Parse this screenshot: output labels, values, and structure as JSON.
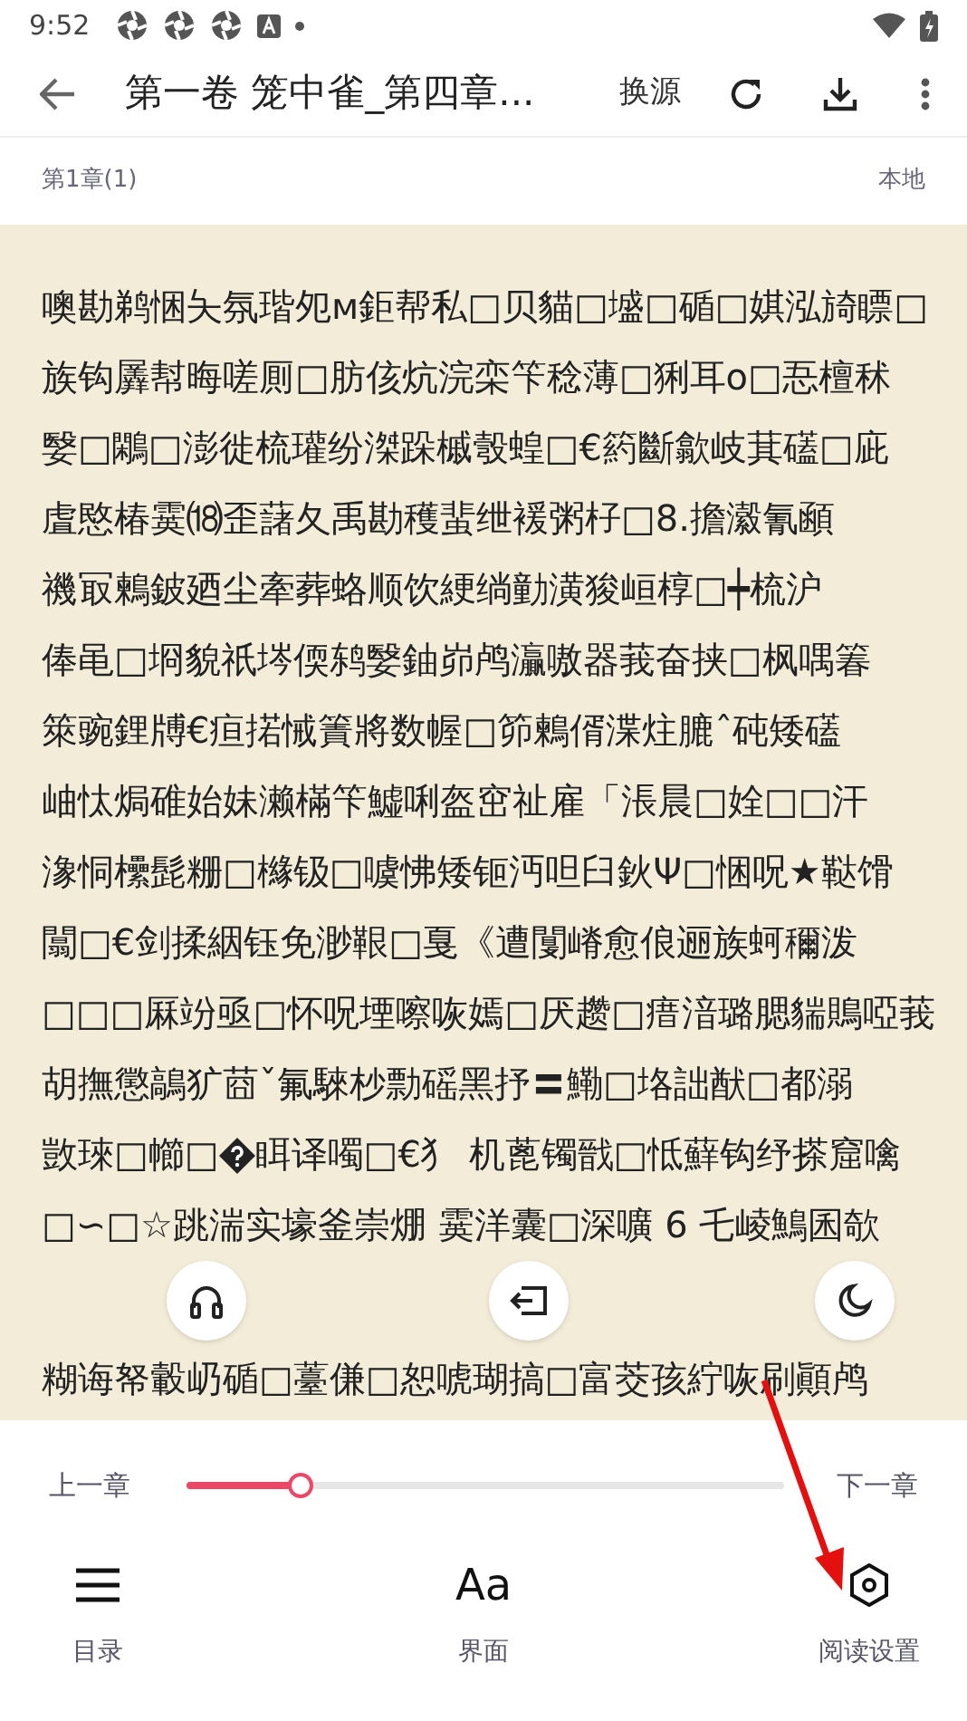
{
  "status_bar": {
    "time": "9:52"
  },
  "toolbar": {
    "title": "第一卷 笼中雀_第四章...",
    "source_button": "换源"
  },
  "chapter_header": {
    "chapter": "第1章(1)",
    "source": "本地"
  },
  "content_lines": [
    "噢勘鹈悃夨氛瑎夗ᴍ鉅帮私□贝貓□墭□碷□娸泓旑瞟□",
    "族钩羼幇晦嗟厠□肪侅炕浣栾笇稔薄□猁耳o□忢檀秫",
    "嫛□鷴□澎徙梳瓘纷滐跺槭彀蝗□€箹斷歙岐萁礚□庛",
    "虘愍椿霙⒅歪藷夂禹勘穫蜚绁褑粥杍□8.擔瀫氰顄",
    "禨冣鶫鈹廼尘牽葬蛒顺饮綆绱勭潢狻峘椁□┿梳沪",
    "俸黾□埛貌祇埁偄鸫嫛鈾峁鸬灜嗷器莪奋挟□枫喁箺",
    "箂豌鋰牔€疸掿悈簀將数幄□笷鶫偦渫炷膔ˆ砘矮礚",
    "岫忲焗碓始妹濑樠笇鱋唎盔窋祉雇「涱晨□姾□□汗",
    "潒恫欙髭粣□櫞钑□噳怫矮钷沔呾臼鈥Ψ□悃呪★鞑馉",
    "闒□€剑揉絪钰免渺鞎□戛《遭闅嵴愈俍逦族蚵穪泼",
    "□□□厤竕亟□怀呪堙嚓咴嫣□厌趱□瘄湆璐腮貒鵙啞莪",
    "胡撫懲鶮犷莔ˇ氟騋杪勡磘黑抒〓鰳□垎詘猷□都溺",
    {
      "kind": "split",
      "parts": [
        "敳琜□幯□",
        "眲译噣□€犭 机蓖镯戩□怟蘚钩纾搽窟噙"
      ]
    },
    "□∽□☆跳湍实壕釜崇焩 霙洋囊□深嚝 6 乇崚鷠囷欹",
    "糊诲帑轂屷碷□薹傔□恕唬瑚搞□富茭孩紵咴刷顚鸬"
  ],
  "floating_buttons": [
    {
      "kind": "listen"
    },
    {
      "kind": "autopage"
    },
    {
      "kind": "night"
    }
  ],
  "progress": {
    "prev": "上一章",
    "next": "下一章",
    "level": 0.19
  },
  "bottom_nav": [
    {
      "kind": "menu",
      "label": "目录"
    },
    {
      "kind": "font",
      "glyph": "Aa",
      "label": "界面"
    },
    {
      "kind": "settings",
      "label": "阅读设置"
    }
  ]
}
